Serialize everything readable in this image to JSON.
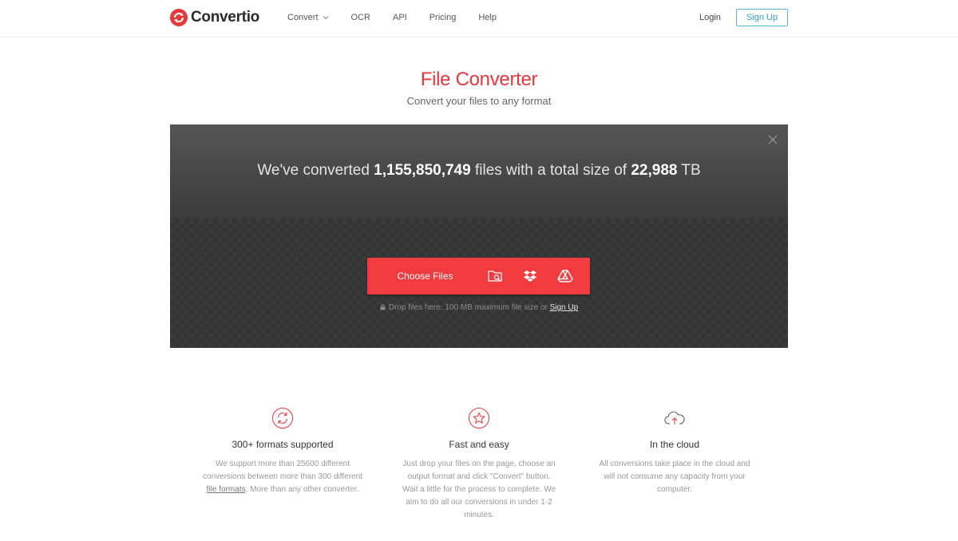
{
  "header": {
    "brand": "Convertio",
    "nav": [
      {
        "label": "Convert",
        "icon": "chevron-down-icon"
      },
      {
        "label": "OCR"
      },
      {
        "label": "API"
      },
      {
        "label": "Pricing"
      },
      {
        "label": "Help"
      }
    ],
    "login_label": "Login",
    "signup_label": "Sign Up"
  },
  "hero": {
    "title": "File Converter",
    "subtitle": "Convert your files to any format"
  },
  "converter": {
    "stats_prefix": "We've converted ",
    "files_count": "1,155,850,749",
    "stats_middle": " files with a total size of ",
    "total_size": "22,988",
    "stats_suffix": " TB",
    "choose_label": "Choose Files",
    "sources": [
      "folder-search-icon",
      "dropbox-icon",
      "google-drive-icon"
    ],
    "drop_note_prefix": "Drop files here. 100 MB maximum file size or ",
    "drop_note_link": "Sign Up"
  },
  "features": [
    {
      "icon": "refresh-icon",
      "title": "300+ formats supported",
      "text_before": "We support more than 25600 different conversions between more than 300 different ",
      "link": "file formats",
      "text_after": ". More than any other converter."
    },
    {
      "icon": "star-icon",
      "title": "Fast and easy",
      "text": "Just drop your files on the page, choose an output format and click \"Convert\" button. Wait a little for the process to complete. We aim to do all our conversions in under 1-2 minutes."
    },
    {
      "icon": "cloud-upload-icon",
      "title": "In the cloud",
      "text": "All conversions take place in the cloud and will not consume any capacity from your computer."
    }
  ],
  "colors": {
    "brand_red": "#f23b3f",
    "title_red": "#e8373b",
    "signup_blue": "#53b6d8"
  }
}
